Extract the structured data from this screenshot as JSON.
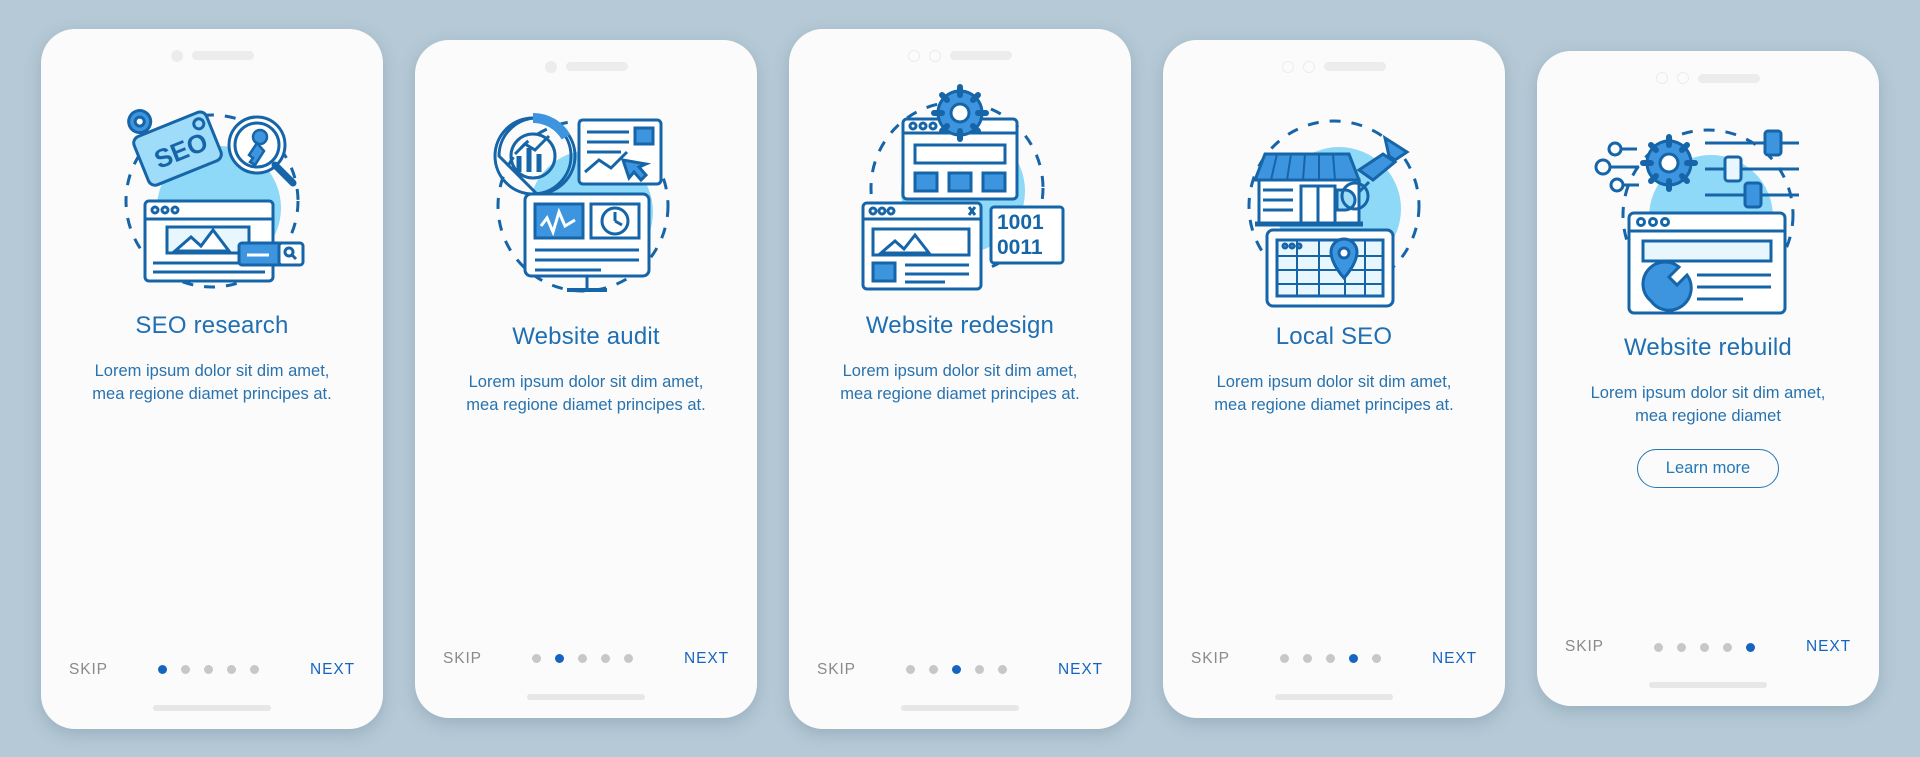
{
  "theme": {
    "page_background": "#b5c9d6",
    "card_background": "#fbfbfb",
    "title_color": "#1f6fb2",
    "body_color": "#2872ae",
    "accent_color": "#1565c0",
    "skip_color": "#8a8a8a",
    "dot_inactive_color": "#c7c7c7",
    "illustration_blob": "#8ed8f8",
    "illustration_stroke": "#1565a8",
    "illustration_fill": "#3d95e0"
  },
  "common": {
    "skip_label": "SKIP",
    "next_label": "NEXT",
    "total_dots": 5
  },
  "screens": [
    {
      "id": "seo-research",
      "title": "SEO research",
      "description": "Lorem ipsum dolor sit dim amet, mea regione diamet principes at.",
      "active_dot": 1,
      "has_learn_more": false,
      "learn_more_label": "",
      "illustration": "seo-tag-key-icon",
      "status_dots": 1,
      "height_class": "tall"
    },
    {
      "id": "website-audit",
      "title": "Website audit",
      "description": "Lorem ipsum dolor sit dim amet, mea regione diamet principes at.",
      "active_dot": 2,
      "has_learn_more": false,
      "learn_more_label": "",
      "illustration": "audit-chart-monitor-icon",
      "status_dots": 1,
      "height_class": "mid"
    },
    {
      "id": "website-redesign",
      "title": "Website redesign",
      "description": "Lorem ipsum dolor sit dim amet, mea regione diamet principes at.",
      "active_dot": 3,
      "has_learn_more": false,
      "learn_more_label": "",
      "illustration": "redesign-gear-binary-icon",
      "status_dots": 2,
      "binary_lines": [
        "1001",
        "0011"
      ],
      "height_class": "tall"
    },
    {
      "id": "local-seo",
      "title": "Local SEO",
      "description": "Lorem ipsum dolor sit dim amet, mea regione diamet principes at.",
      "active_dot": 4,
      "has_learn_more": false,
      "learn_more_label": "",
      "illustration": "local-store-map-pin-icon",
      "status_dots": 2,
      "height_class": "mid"
    },
    {
      "id": "website-rebuild",
      "title": "Website rebuild",
      "description": "Lorem ipsum dolor sit dim amet, mea regione diamet",
      "active_dot": 5,
      "has_learn_more": true,
      "learn_more_label": "Learn more",
      "illustration": "rebuild-gear-sliders-icon",
      "status_dots": 2,
      "height_class": "short"
    }
  ]
}
